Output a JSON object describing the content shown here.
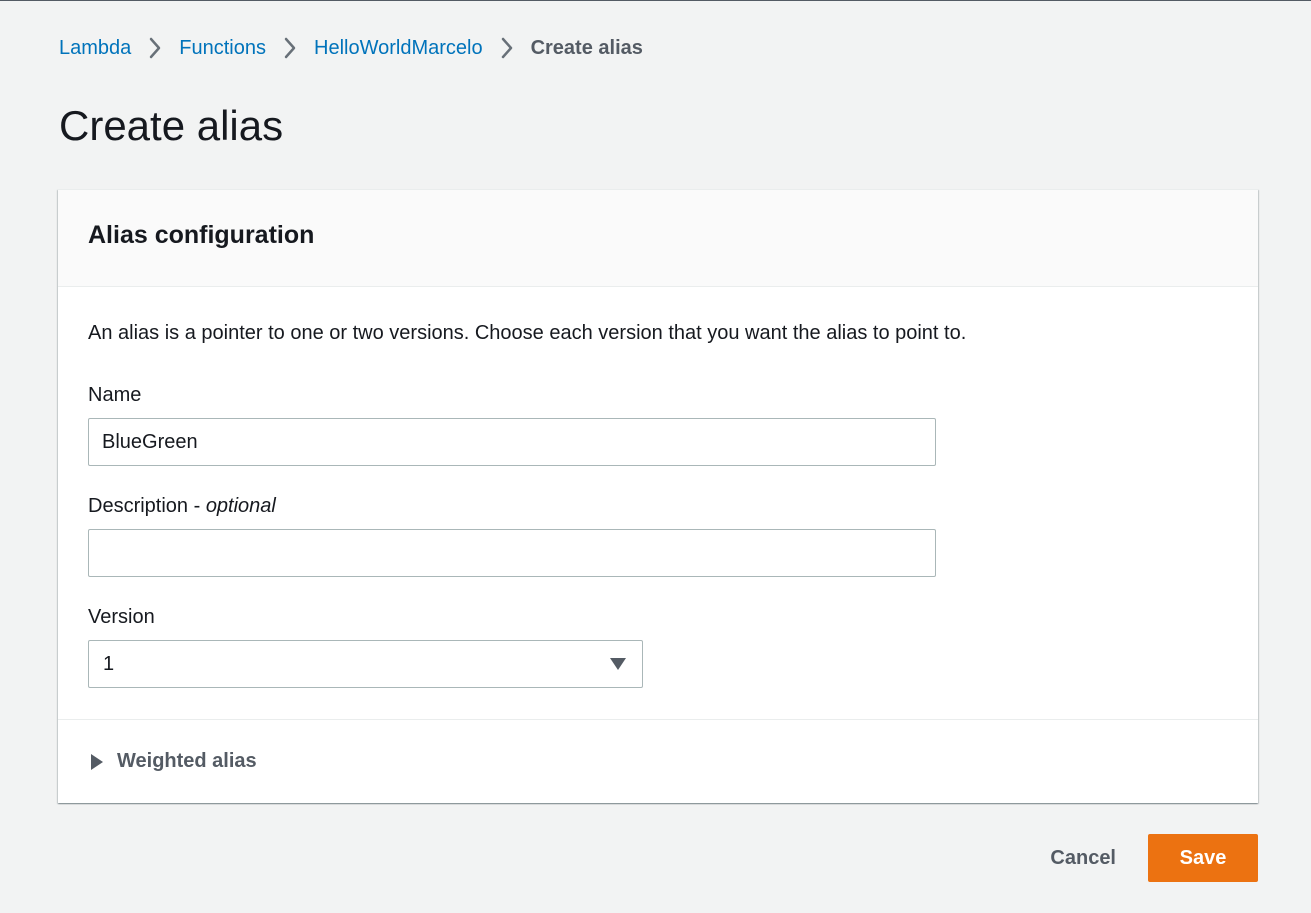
{
  "breadcrumb": {
    "items": [
      {
        "label": "Lambda"
      },
      {
        "label": "Functions"
      },
      {
        "label": "HelloWorldMarcelo"
      },
      {
        "label": "Create alias"
      }
    ]
  },
  "page": {
    "title": "Create alias"
  },
  "panel": {
    "title": "Alias configuration",
    "intro": "An alias is a pointer to one or two versions. Choose each version that you want the alias to point to.",
    "name_field": {
      "label": "Name",
      "value": "BlueGreen"
    },
    "description_field": {
      "label": "Description - ",
      "label_optional": "optional",
      "value": ""
    },
    "version_field": {
      "label": "Version",
      "selected": "1"
    },
    "weighted_alias": {
      "label": "Weighted alias"
    }
  },
  "actions": {
    "cancel_label": "Cancel",
    "save_label": "Save"
  },
  "colors": {
    "link": "#0073bb",
    "primary_button": "#ec7211",
    "background": "#f2f3f3"
  }
}
